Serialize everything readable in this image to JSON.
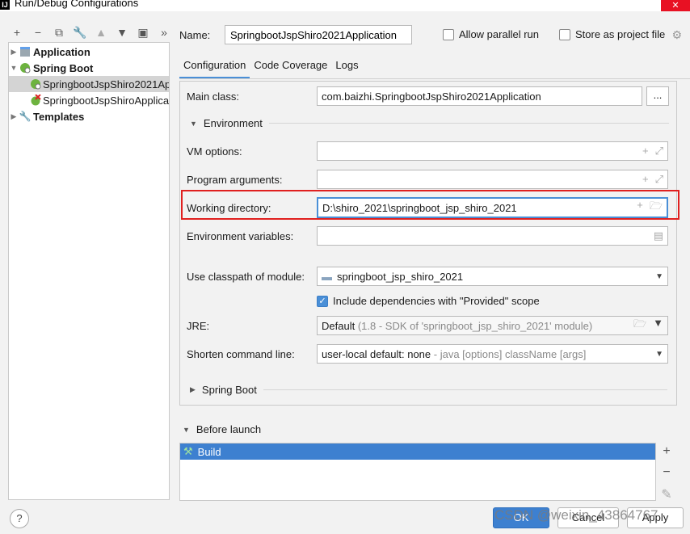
{
  "window": {
    "title": "Run/Debug Configurations",
    "app_icon": "IJ"
  },
  "toolbar": {
    "icons": [
      "plus-icon",
      "minus-icon",
      "copy-icon",
      "wrench-icon",
      "arrow-up-icon",
      "arrow-down-icon",
      "folder-add-icon",
      "more-icon"
    ]
  },
  "tree": {
    "items": [
      {
        "label": "Application",
        "bold": true
      },
      {
        "label": "Spring Boot",
        "bold": true
      },
      {
        "label": "SpringbootJspShiro2021Application",
        "bold": false
      },
      {
        "label": "SpringbootJspShiroApplication",
        "bold": false
      },
      {
        "label": "Templates",
        "bold": true
      }
    ]
  },
  "header": {
    "name_label": "Name:",
    "name_value": "SpringbootJspShiro2021Application",
    "allow_parallel_label": "Allow parallel run",
    "store_project_label": "Store as project file"
  },
  "tabs": [
    {
      "label": "Configuration",
      "active": true
    },
    {
      "label": "Code Coverage",
      "active": false
    },
    {
      "label": "Logs",
      "active": false
    }
  ],
  "form": {
    "main_class_label": "Main class:",
    "main_class_value": "com.baizhi.SpringbootJspShiro2021Application",
    "main_class_button": "...",
    "environment_section": "Environment",
    "vm_options_label": "VM options:",
    "vm_options_value": "",
    "program_args_label": "Program arguments:",
    "program_args_value": "",
    "working_dir_label": "Working directory:",
    "working_dir_value": "D:\\shiro_2021\\springboot_jsp_shiro_2021",
    "env_vars_label": "Environment variables:",
    "env_vars_value": "",
    "classpath_label": "Use classpath of module:",
    "classpath_value": "springboot_jsp_shiro_2021",
    "include_deps_label": "Include dependencies with \"Provided\" scope",
    "include_deps_checked": true,
    "jre_label": "JRE:",
    "jre_value": "Default",
    "jre_hint": "(1.8 - SDK of 'springboot_jsp_shiro_2021' module)",
    "shorten_label": "Shorten command line:",
    "shorten_value": "user-local default: none",
    "shorten_hint": "- java [options] className [args]",
    "spring_boot_section": "Spring Boot"
  },
  "before_launch": {
    "title": "Before launch",
    "items": [
      "Build"
    ]
  },
  "footer": {
    "help": "?",
    "ok": "OK",
    "cancel": "Cancel",
    "apply": "Apply",
    "watermark": "CSDN @weixin_43864767"
  }
}
